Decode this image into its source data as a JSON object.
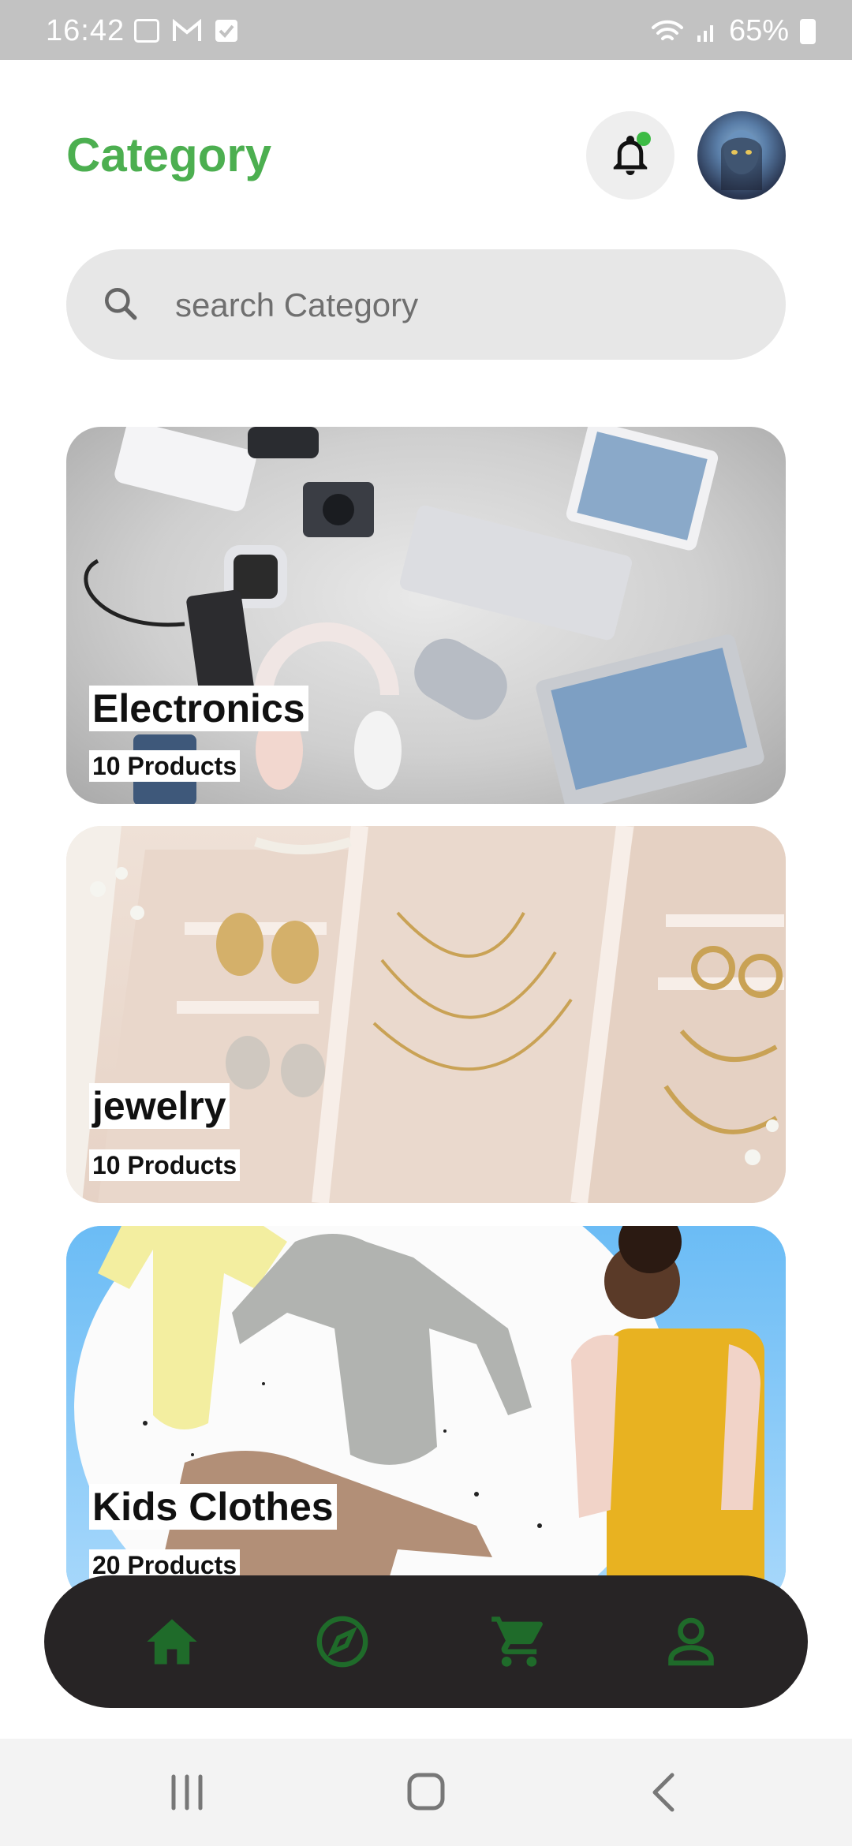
{
  "status_bar": {
    "time": "16:42",
    "battery": "65%",
    "icons_left": [
      "image-icon",
      "gmail-icon",
      "checkbox-icon"
    ],
    "icons_right": [
      "wifi-icon",
      "signal-icon",
      "battery-icon"
    ]
  },
  "header": {
    "title": "Category",
    "notification_icon": "bell-icon",
    "has_unread_dot": true
  },
  "search": {
    "placeholder": "search Category",
    "icon": "search-icon"
  },
  "categories": [
    {
      "name": "Electronics",
      "count_label": "10 Products"
    },
    {
      "name": "jewelry",
      "count_label": "10 Products"
    },
    {
      "name": "Kids Clothes",
      "count_label": "20 Products"
    }
  ],
  "bottom_nav": {
    "items": [
      "home-icon",
      "compass-icon",
      "cart-icon",
      "profile-icon"
    ],
    "active_index": 0
  },
  "system_nav": [
    "recent-apps-icon",
    "home-circle-icon",
    "back-icon"
  ],
  "colors": {
    "accent_green": "#4caf50",
    "nav_icon_green": "#1f6b2a",
    "nav_background": "#272425",
    "search_background": "#e7e7e7",
    "status_bar": "#c2c2c2"
  }
}
